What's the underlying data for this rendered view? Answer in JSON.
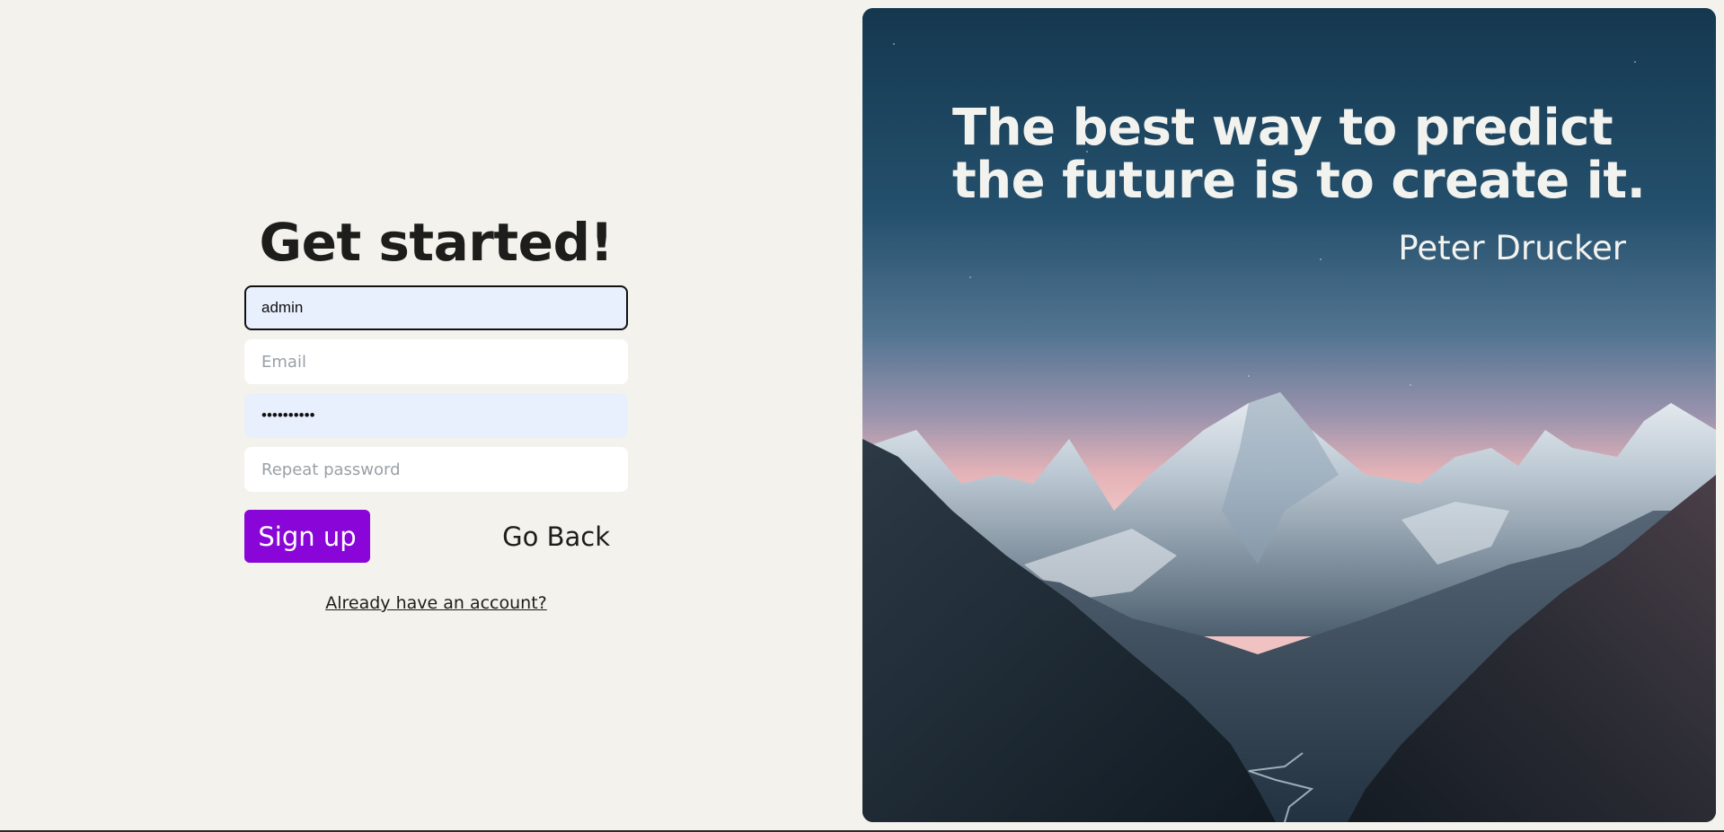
{
  "signup": {
    "title": "Get started!",
    "username_value": "admin",
    "email_placeholder": "Email",
    "password_value": "password12",
    "repeat_password_placeholder": "Repeat password",
    "signup_label": "Sign up",
    "go_back_label": "Go Back",
    "login_link_label": "Already have an account?"
  },
  "quote": {
    "text": "The best way to predict the future is to create it.",
    "author": "Peter Drucker"
  },
  "colors": {
    "background": "#f3f2ec",
    "accent": "#8a05d8",
    "autofill": "#e8effd"
  }
}
